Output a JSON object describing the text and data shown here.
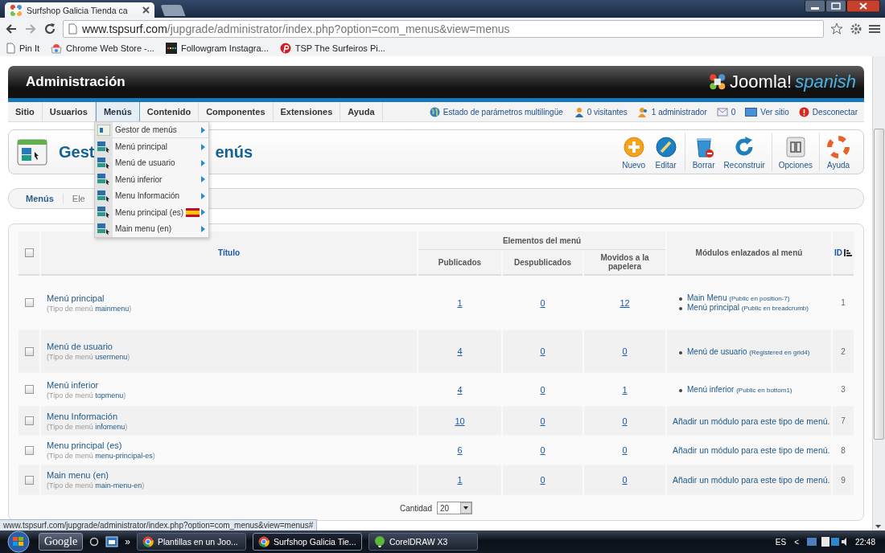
{
  "browser": {
    "tab_title": "Surfshop Galicia Tienda ca",
    "url_host": "www.tspsurf.com",
    "url_path": "/jupgrade/administrator/index.php?option=com_menus&view=menus",
    "bookmarks": [
      {
        "label": "Pin It",
        "kind": "page"
      },
      {
        "label": "Chrome Web Store -...",
        "kind": "store"
      },
      {
        "label": "Followgram Instagra...",
        "kind": "followgram"
      },
      {
        "label": "TSP The Surfeiros Pi...",
        "kind": "pinterest"
      }
    ]
  },
  "admin": {
    "title": "Administración",
    "logo": "Joomla!",
    "logo_suffix": "spanish"
  },
  "nav": {
    "items": [
      {
        "label": "Sitio",
        "selected": false
      },
      {
        "label": "Usuarios",
        "selected": false
      },
      {
        "label": "Menús",
        "selected": true
      },
      {
        "label": "Contenido",
        "selected": false
      },
      {
        "label": "Componentes",
        "selected": false
      },
      {
        "label": "Extensiones",
        "selected": false
      },
      {
        "label": "Ayuda",
        "selected": false
      }
    ],
    "status": [
      {
        "kind": "globe",
        "text": "Estado de parámetros multilingüe"
      },
      {
        "kind": "visitors",
        "text": "0 visitantes"
      },
      {
        "kind": "admins",
        "text": "1 administrador"
      },
      {
        "kind": "messages",
        "text": "0"
      },
      {
        "kind": "site",
        "text": "Ver sitio"
      },
      {
        "kind": "logout",
        "text": "Desconectar"
      }
    ]
  },
  "dropdown": {
    "items": [
      {
        "label": "Gestor de menús",
        "kind": "manager",
        "flag": false
      },
      {
        "label": "Menú principal",
        "kind": "menu",
        "flag": false
      },
      {
        "label": "Menú de usuario",
        "kind": "menu",
        "flag": false
      },
      {
        "label": "Menú inferior",
        "kind": "menu",
        "flag": false
      },
      {
        "label": "Menu Información",
        "kind": "menu",
        "flag": false
      },
      {
        "label": "Menu principal (es)",
        "kind": "menu",
        "flag": true
      },
      {
        "label": "Main menu (en)",
        "kind": "menu",
        "flag": false
      }
    ]
  },
  "toolbar": {
    "title_parts": [
      "Gest",
      "enús"
    ],
    "groups": [
      [
        {
          "label": "Nuevo",
          "kind": "new"
        },
        {
          "label": "Editar",
          "kind": "edit"
        }
      ],
      [
        {
          "label": "Borrar",
          "kind": "delete"
        },
        {
          "label": "Reconstruir",
          "kind": "rebuild"
        }
      ],
      [
        {
          "label": "Opciones",
          "kind": "options"
        }
      ],
      [
        {
          "label": "Ayuda",
          "kind": "help"
        }
      ]
    ]
  },
  "subtabs": [
    {
      "label": "Menús",
      "selected": true
    },
    {
      "label": "Ele",
      "selected": false
    }
  ],
  "table": {
    "select_all": {
      "checked": false
    },
    "title_heading": "Título",
    "group_heading": "Elementos del menú",
    "count_headings": [
      "Publicados",
      "Despublicados",
      "Movidos a la papelera"
    ],
    "modules_heading": "Módulos enlazados al menú",
    "id_heading": "ID",
    "rows": [
      {
        "checked": false,
        "title": "Menú principal",
        "type_line": "(Tipo de menú **mainmenu**)",
        "counts": [
          "1",
          "0",
          "12"
        ],
        "modules": [
          {
            "name": "Main Menu",
            "detail": "(Public en position-7)"
          },
          {
            "name": "Menú principal",
            "detail": "(Public en breadcrumb)"
          }
        ],
        "id": "1"
      },
      {
        "checked": false,
        "title": "Menú de usuario",
        "type_line": "(Tipo de menú **usermenu**)",
        "counts": [
          "4",
          "0",
          "0"
        ],
        "modules": [
          {
            "name": "Menú de usuario",
            "detail": "(Registered en grid4)"
          }
        ],
        "id": "2"
      },
      {
        "checked": false,
        "title": "Menú inferior",
        "type_line": "(Tipo de menú **topmenu**)",
        "counts": [
          "4",
          "0",
          "1"
        ],
        "modules": [
          {
            "name": "Menú inferior",
            "detail": "(Public en bottom1)"
          }
        ],
        "id": "3"
      },
      {
        "checked": false,
        "title": "Menu Información",
        "type_line": "(Tipo de menú **infomenu**)",
        "counts": [
          "10",
          "0",
          "0"
        ],
        "add_module": "Añadir un módulo para este tipo de menú.",
        "id": "7"
      },
      {
        "checked": false,
        "title": "Menu principal (es)",
        "type_line": "(Tipo de menú **menu-principal-es**)",
        "counts": [
          "6",
          "0",
          "0"
        ],
        "add_module": "Añadir un módulo para este tipo de menú.",
        "id": "8"
      },
      {
        "checked": false,
        "title": "Main menu (en)",
        "type_line": "(Tipo de menú **main-menu-en**)",
        "counts": [
          "1",
          "0",
          "0"
        ],
        "add_module": "Añadir un módulo para este tipo de menú.",
        "id": "9"
      }
    ],
    "limit_label": "Cantidad",
    "limit_value": "20"
  },
  "status_url": "www.tspsurf.com/jupgrade/administrator/index.php?option=com_menus&view=menus#",
  "taskbar": {
    "search": "Google",
    "more": "»",
    "tasks": [
      {
        "label": "Plantillas en un Joo...",
        "kind": "chrome",
        "selected": false
      },
      {
        "label": "Surfshop Galicia Tie...",
        "kind": "chrome",
        "selected": true
      },
      {
        "label": "CorelDRAW X3",
        "kind": "corel",
        "selected": false
      }
    ],
    "language": "ES",
    "tray_toggle": "<",
    "clock": "22:48"
  }
}
